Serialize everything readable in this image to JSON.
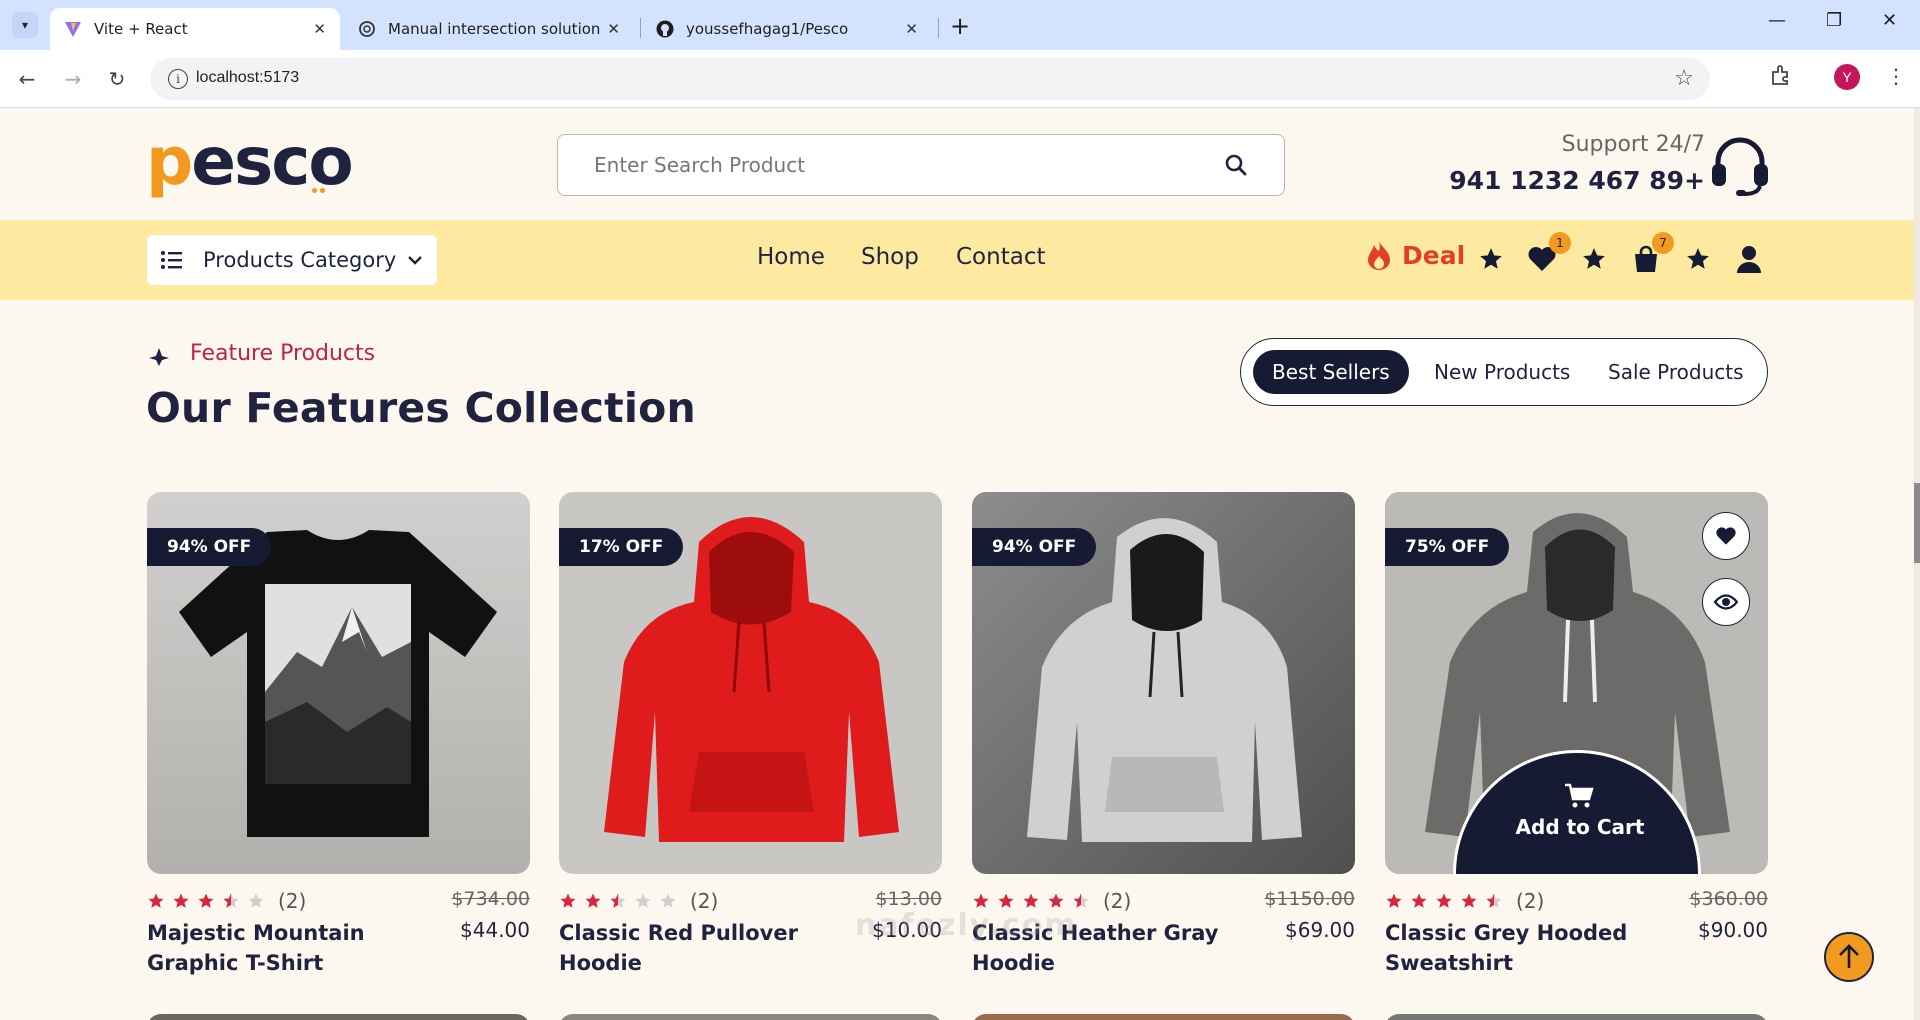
{
  "browser": {
    "tabs": [
      {
        "title": "Vite + React",
        "active": true,
        "icon": "vite-icon"
      },
      {
        "title": "Manual intersection solution",
        "active": false,
        "icon": "chatgpt-icon"
      },
      {
        "title": "youssefhagag1/Pesco",
        "active": false,
        "icon": "github-icon"
      }
    ],
    "url": "localhost:5173",
    "profile_initial": "Y"
  },
  "header": {
    "logo_text": "pesco",
    "search_placeholder": "Enter Search Product",
    "support_label": "Support 24/7",
    "support_phone": "941 1232 467 89+"
  },
  "nav": {
    "category_label": "Products Category",
    "links": [
      "Home",
      "Shop",
      "Contact"
    ],
    "deal_label": "Deal",
    "wishlist_count": "1",
    "cart_count": "7"
  },
  "section": {
    "eyebrow": "Feature Products",
    "title": "Our Features Collection",
    "filters": [
      "Best Sellers",
      "New Products",
      "Sale Products"
    ],
    "active_filter": "Best Sellers"
  },
  "products": [
    {
      "name": "Majestic Mountain Graphic T-Shirt",
      "discount": "94% OFF",
      "old_price": "$734.00",
      "price": "$44.00",
      "rating": 3.5,
      "reviews": "(2)"
    },
    {
      "name": "Classic Red Pullover Hoodie",
      "discount": "17% OFF",
      "old_price": "$13.00",
      "price": "$10.00",
      "rating": 2.5,
      "reviews": "(2)"
    },
    {
      "name": "Classic Heather Gray Hoodie",
      "discount": "94% OFF",
      "old_price": "$1150.00",
      "price": "$69.00",
      "rating": 4.5,
      "reviews": "(2)"
    },
    {
      "name": "Classic Grey Hooded Sweatshirt",
      "discount": "75% OFF",
      "old_price": "$360.00",
      "price": "$90.00",
      "rating": 4.5,
      "reviews": "(2)"
    }
  ],
  "hover_card": {
    "add_to_cart_label": "Add to Cart"
  },
  "watermark": "nafezly.com",
  "colors": {
    "accent": "#f29a1f",
    "navy": "#161b33",
    "nav_bg": "#fdeaa0",
    "star": "#d8263f",
    "deal": "#e23f2a"
  }
}
